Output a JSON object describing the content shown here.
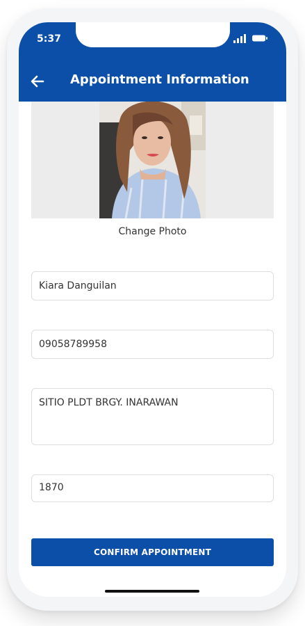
{
  "status_bar": {
    "time": "5:37",
    "signal_icon": "signal-icon",
    "battery_icon": "battery-icon"
  },
  "header": {
    "title": "Appointment Information",
    "back_icon": "arrow-left-icon"
  },
  "photo": {
    "change_label": "Change Photo"
  },
  "form": {
    "name_value": "Kiara Danguilan",
    "phone_value": "09058789958",
    "address_value": "SITIO PLDT BRGY. INARAWAN",
    "zip_value": "1870"
  },
  "actions": {
    "confirm_label": "CONFIRM APPOINTMENT"
  },
  "colors": {
    "brand": "#0b4fa8",
    "field_border": "#dedede",
    "photo_bg": "#ececec"
  }
}
